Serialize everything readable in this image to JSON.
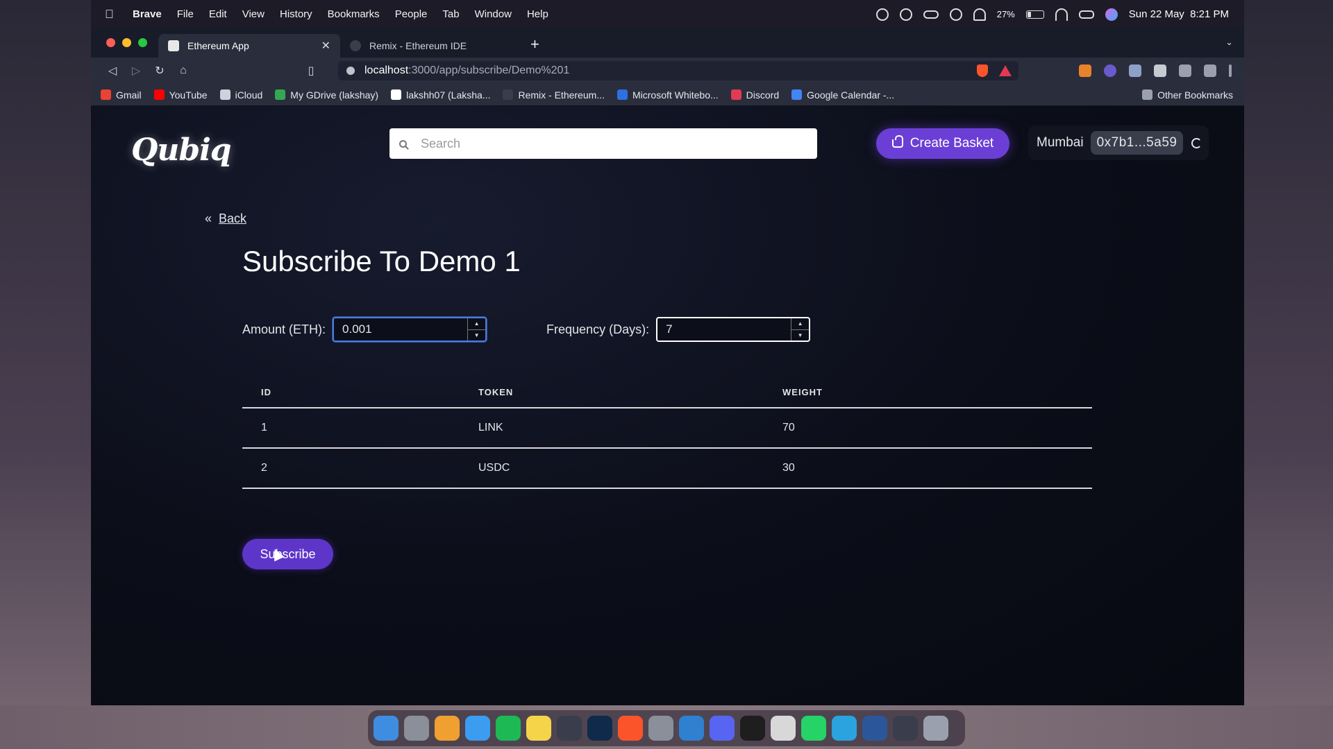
{
  "menubar": {
    "app_name": "Brave",
    "items": [
      "File",
      "Edit",
      "View",
      "History",
      "Bookmarks",
      "People",
      "Tab",
      "Window",
      "Help"
    ],
    "battery_percent": "27%",
    "battery_level": 0.27,
    "datetime": "Sun 22 May  8:21 PM"
  },
  "browser": {
    "tabs": [
      {
        "label": "Ethereum App",
        "active": true
      },
      {
        "label": "Remix - Ethereum IDE",
        "active": false
      }
    ],
    "url_host": "localhost",
    "url_path": ":3000/app/subscribe/Demo%201",
    "bookmarks": [
      {
        "label": "Gmail",
        "color": "#ea4335"
      },
      {
        "label": "YouTube",
        "color": "#ff0000"
      },
      {
        "label": "iCloud",
        "color": "#cfd2da"
      },
      {
        "label": "My GDrive (lakshay)",
        "color": "#34a853"
      },
      {
        "label": "lakshh07 (Laksha...",
        "color": "#ffffff"
      },
      {
        "label": "Remix - Ethereum...",
        "color": "#3a3d4c"
      },
      {
        "label": "Microsoft Whitebo...",
        "color": "#2f6fe0"
      },
      {
        "label": "Discord",
        "color": "#e23a52"
      },
      {
        "label": "Google Calendar -...",
        "color": "#4285f4"
      }
    ],
    "other_bookmarks": "Other Bookmarks"
  },
  "app": {
    "logo": "Qubiq",
    "search_placeholder": "Search",
    "create_basket": "Create Basket",
    "network": "Mumbai",
    "address": "0x7b1...5a59",
    "back_label": "Back",
    "page_title": "Subscribe To Demo 1",
    "amount_label": "Amount (ETH):",
    "amount_value": "0.001",
    "frequency_label": "Frequency (Days):",
    "frequency_value": "7",
    "table": {
      "headers": [
        "ID",
        "TOKEN",
        "WEIGHT"
      ],
      "rows": [
        {
          "id": "1",
          "token": "LINK",
          "weight": "70"
        },
        {
          "id": "2",
          "token": "USDC",
          "weight": "30"
        }
      ]
    },
    "subscribe_label": "Subscribe"
  },
  "colors": {
    "accent": "#6b3fd6",
    "background": "#0b0d18"
  },
  "dock_apps": [
    "finder-icon",
    "launchpad-icon",
    "sublime-icon",
    "safari-icon",
    "spotify-icon",
    "notes-icon",
    "obs-icon",
    "photoshop-icon",
    "brave-icon",
    "settings-icon",
    "vscode-icon",
    "discord-icon",
    "terminal-icon",
    "script-editor-icon",
    "whatsapp-icon",
    "telegram-icon",
    "word-icon",
    "screenshot-icon",
    "trash-icon"
  ]
}
